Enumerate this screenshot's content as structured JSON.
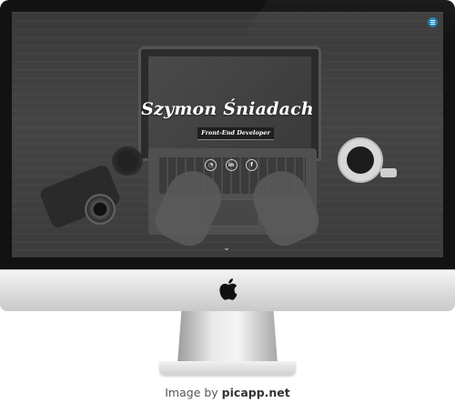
{
  "hero": {
    "name": "Szymon Śniadach",
    "role": "Front-End Developer"
  },
  "social": [
    {
      "icon": "github-icon",
      "glyph": "◔"
    },
    {
      "icon": "linkedin-icon",
      "glyph": "in"
    },
    {
      "icon": "facebook-icon",
      "glyph": "f"
    }
  ],
  "scroll_hint_glyph": "⌄",
  "credit": {
    "prefix": "Image by ",
    "site": "picapp.net"
  },
  "colors": {
    "menu_button": "#1f7fb8",
    "bezel": "#121212",
    "hero_text": "#ffffff"
  }
}
